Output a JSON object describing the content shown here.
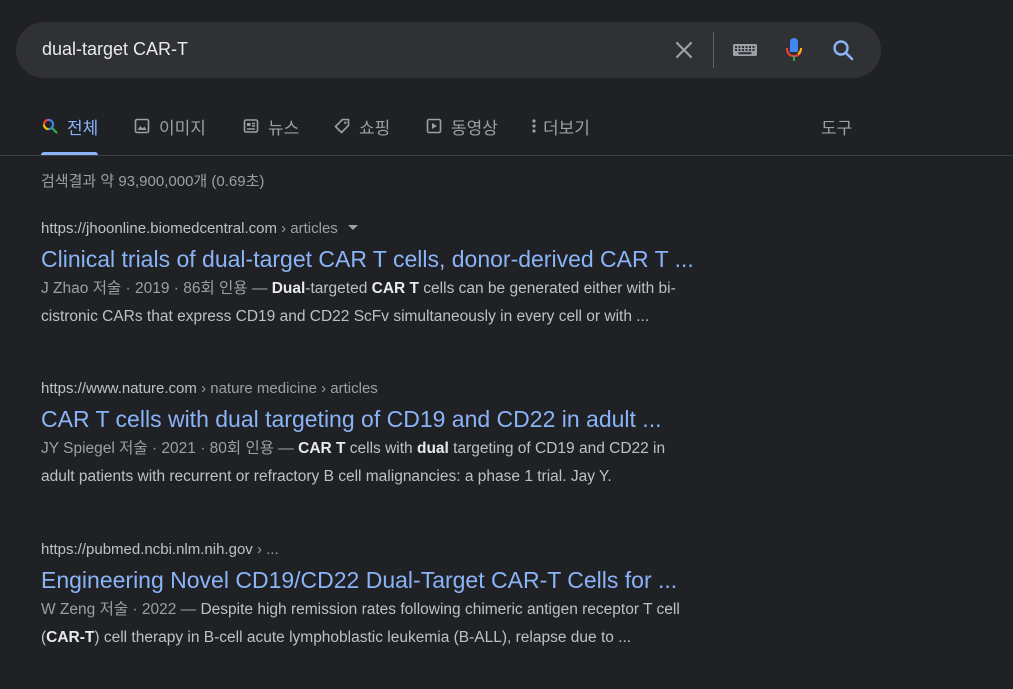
{
  "search": {
    "query": "dual-target CAR-T"
  },
  "tabs": [
    {
      "label": "전체",
      "icon": "search-icon",
      "active": true
    },
    {
      "label": "이미지",
      "icon": "image-icon"
    },
    {
      "label": "뉴스",
      "icon": "news-icon"
    },
    {
      "label": "쇼핑",
      "icon": "tag-icon"
    },
    {
      "label": "동영상",
      "icon": "video-icon"
    },
    {
      "label": "더보기",
      "icon": "more-vert-icon"
    }
  ],
  "tools_label": "도구",
  "stats": "검색결과 약 93,900,000개 (0.69초)",
  "colors": {
    "background": "#202124",
    "link": "#8ab4f8",
    "text": "#bdc1c6",
    "muted": "#9aa0a6"
  },
  "results": [
    {
      "url_host": "https://jhoonline.biomedcentral.com",
      "url_crumb": " › articles",
      "title": "Clinical trials of dual-target CAR T cells, donor-derived CAR T ...",
      "meta": "J Zhao 저술 · 2019 · 86회 인용 — ",
      "snippet_line1": [
        {
          "t": "Dual",
          "b": true
        },
        {
          "t": "-targeted ",
          "b": false
        },
        {
          "t": "CAR T",
          "b": true
        },
        {
          "t": " cells can be generated either with bi-",
          "b": false
        }
      ],
      "snippet_line2": "cistronic CARs that express CD19 and CD22 ScFv simultaneously in every cell or with ..."
    },
    {
      "url_host": "https://www.nature.com",
      "url_crumb": " › nature medicine › articles",
      "title": "CAR T cells with dual targeting of CD19 and CD22 in adult ...",
      "meta": "JY Spiegel 저술 · 2021 · 80회 인용 — ",
      "snippet_line1": [
        {
          "t": "CAR T",
          "b": true
        },
        {
          "t": " cells with ",
          "b": false
        },
        {
          "t": "dual",
          "b": true
        },
        {
          "t": " targeting of CD19 and CD22 in",
          "b": false
        }
      ],
      "snippet_line2": "adult patients with recurrent or refractory B cell malignancies: a phase 1 trial. Jay Y."
    },
    {
      "url_host": "https://pubmed.ncbi.nlm.nih.gov",
      "url_crumb": " › ...",
      "title": "Engineering Novel CD19/CD22 Dual-Target CAR-T Cells for ...",
      "meta": "W Zeng 저술 · 2022 — ",
      "snippet_line1": [
        {
          "t": "Despite high remission rates following chimeric antigen receptor T cell",
          "b": false
        }
      ],
      "snippet_line2_parts": [
        {
          "t": "(",
          "b": false
        },
        {
          "t": "CAR-T",
          "b": true
        },
        {
          "t": ") cell therapy in B-cell acute lymphoblastic leukemia (B-ALL), relapse due to ...",
          "b": false
        }
      ]
    }
  ]
}
